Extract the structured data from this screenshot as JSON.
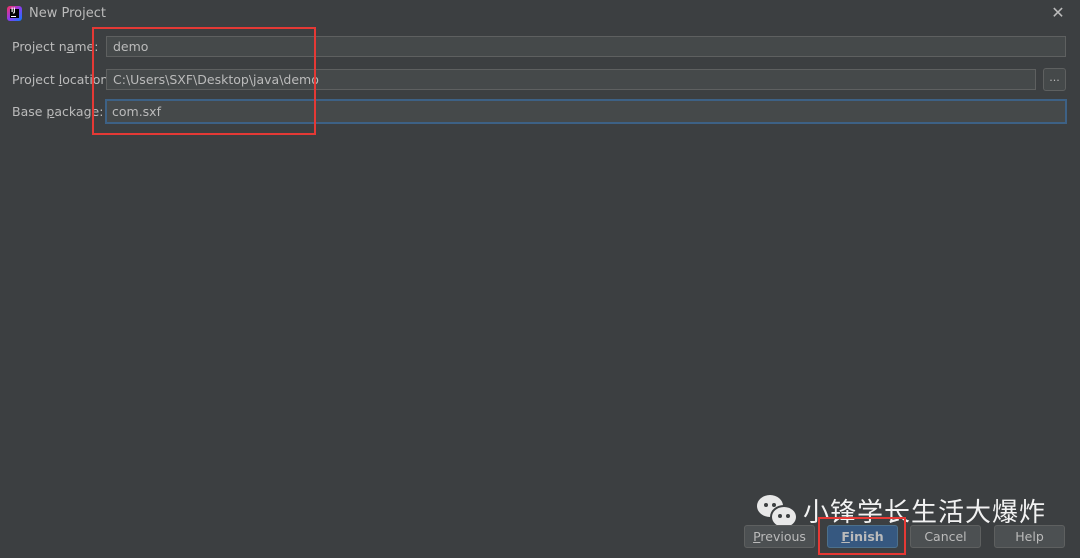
{
  "window": {
    "title": "New Project",
    "app_icon": "intellij-idea-icon",
    "close_icon": "close-icon"
  },
  "form": {
    "project_name": {
      "label_pre": "Project n",
      "label_mnemonic": "a",
      "label_post": "me:",
      "value": "demo"
    },
    "project_location": {
      "label_pre": "Project ",
      "label_mnemonic": "l",
      "label_post": "ocation:",
      "value": "C:\\Users\\SXF\\Desktop\\java\\demo",
      "browse_label": "..."
    },
    "base_package": {
      "label_pre": "Base ",
      "label_mnemonic": "p",
      "label_post": "ackage:",
      "value": "com.sxf"
    }
  },
  "buttons": {
    "previous": {
      "mnemonic": "P",
      "rest": "revious"
    },
    "finish": {
      "mnemonic": "F",
      "rest": "inish"
    },
    "cancel": "Cancel",
    "help": "Help"
  },
  "watermark": {
    "icon": "wechat-icon",
    "text": "小锋学长生活大爆炸"
  },
  "colors": {
    "background": "#3c3f41",
    "field_bg": "#45494a",
    "focus_border": "#3d6185",
    "primary_button": "#365880",
    "annotation_red": "#e53935"
  }
}
